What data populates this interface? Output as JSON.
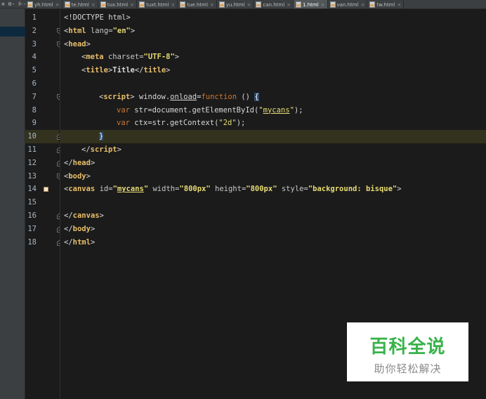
{
  "tabs": [
    {
      "label": "yh.html",
      "active": false
    },
    {
      "label": "te.html",
      "active": false
    },
    {
      "label": "tux.html",
      "active": false
    },
    {
      "label": "tuxt.html",
      "active": false
    },
    {
      "label": "tue.html",
      "active": false
    },
    {
      "label": "yu.html",
      "active": false
    },
    {
      "label": "can.html",
      "active": false
    },
    {
      "label": "1.html",
      "active": true
    },
    {
      "label": "van.html",
      "active": false
    },
    {
      "label": "tw.html",
      "active": false
    }
  ],
  "side_toolbar": "✲ ⚙- ⊩-",
  "editor": {
    "current_line": 10,
    "lines": [
      {
        "n": "1",
        "tokens": [
          [
            "br",
            "<"
          ],
          [
            "plain",
            "!DOCTYPE html"
          ],
          [
            "br",
            ">"
          ]
        ],
        "indent": 0
      },
      {
        "n": "2",
        "tokens": [
          [
            "br",
            "<"
          ],
          [
            "tag",
            "html"
          ],
          [
            "attr",
            " lang="
          ],
          [
            "val",
            "\"en\""
          ],
          [
            "br",
            ">"
          ]
        ],
        "indent": 0
      },
      {
        "n": "3",
        "tokens": [
          [
            "br",
            "<"
          ],
          [
            "tag",
            "head"
          ],
          [
            "br",
            ">"
          ]
        ],
        "indent": 0
      },
      {
        "n": "4",
        "tokens": [
          [
            "br",
            "<"
          ],
          [
            "tag",
            "meta"
          ],
          [
            "attr",
            " charset="
          ],
          [
            "val",
            "\"UTF-8\""
          ],
          [
            "br",
            ">"
          ]
        ],
        "indent": 1
      },
      {
        "n": "5",
        "tokens": [
          [
            "br",
            "<"
          ],
          [
            "tag",
            "title"
          ],
          [
            "br",
            ">"
          ],
          [
            "plainb",
            "Title"
          ],
          [
            "br",
            "</"
          ],
          [
            "tag",
            "title"
          ],
          [
            "br",
            ">"
          ]
        ],
        "indent": 1
      },
      {
        "n": "6",
        "tokens": [],
        "indent": 0
      },
      {
        "n": "7",
        "tokens": [
          [
            "br",
            "<"
          ],
          [
            "tag",
            "script"
          ],
          [
            "br",
            ">"
          ],
          [
            "plain",
            " window."
          ],
          [
            "under",
            "onload"
          ],
          [
            "plain",
            "="
          ],
          [
            "kw",
            "function"
          ],
          [
            "plain",
            " () "
          ],
          [
            "hl",
            "{"
          ]
        ],
        "indent": 2
      },
      {
        "n": "8",
        "tokens": [
          [
            "kw",
            "var"
          ],
          [
            "plain",
            " str=document.getElementById("
          ],
          [
            "strq",
            "\""
          ],
          [
            "struw",
            "mycans"
          ],
          [
            "strq",
            "\""
          ],
          [
            "plain",
            ");"
          ]
        ],
        "indent": 3
      },
      {
        "n": "9",
        "tokens": [
          [
            "kw",
            "var"
          ],
          [
            "plain",
            " ctx=str.getContext("
          ],
          [
            "str",
            "\"2d\""
          ],
          [
            "plain",
            ");"
          ]
        ],
        "indent": 3
      },
      {
        "n": "10",
        "tokens": [
          [
            "hl",
            "}"
          ]
        ],
        "indent": 2
      },
      {
        "n": "11",
        "tokens": [
          [
            "br",
            "</"
          ],
          [
            "tag",
            "script"
          ],
          [
            "br",
            ">"
          ]
        ],
        "indent": 1
      },
      {
        "n": "12",
        "tokens": [
          [
            "br",
            "</"
          ],
          [
            "tag",
            "head"
          ],
          [
            "br",
            ">"
          ]
        ],
        "indent": 0
      },
      {
        "n": "13",
        "tokens": [
          [
            "br",
            "<"
          ],
          [
            "tag",
            "body"
          ],
          [
            "br",
            ">"
          ]
        ],
        "indent": 0
      },
      {
        "n": "14",
        "tokens": [
          [
            "br",
            "<"
          ],
          [
            "tag",
            "canvas"
          ],
          [
            "attr",
            " id="
          ],
          [
            "valq",
            "\""
          ],
          [
            "valu",
            "mycans"
          ],
          [
            "valq",
            "\""
          ],
          [
            "attr",
            " width="
          ],
          [
            "val",
            "\"800px\""
          ],
          [
            "attr",
            " height="
          ],
          [
            "val",
            "\"800px\""
          ],
          [
            "attr",
            " style="
          ],
          [
            "val",
            "\"background: bisque\""
          ],
          [
            "br",
            ">"
          ]
        ],
        "indent": 0
      },
      {
        "n": "15",
        "tokens": [],
        "indent": 0
      },
      {
        "n": "16",
        "tokens": [
          [
            "br",
            "</"
          ],
          [
            "tag",
            "canvas"
          ],
          [
            "br",
            ">"
          ]
        ],
        "indent": 0
      },
      {
        "n": "17",
        "tokens": [
          [
            "br",
            "</"
          ],
          [
            "tag",
            "body"
          ],
          [
            "br",
            ">"
          ]
        ],
        "indent": 0
      },
      {
        "n": "18",
        "tokens": [
          [
            "br",
            "</"
          ],
          [
            "tag",
            "html"
          ],
          [
            "br",
            ">"
          ]
        ],
        "indent": 0
      }
    ]
  },
  "watermark": {
    "title": "百科全说",
    "subtitle": "助你轻松解决"
  },
  "colors": {
    "background": "#1b1b1b",
    "current_line": "#32321e",
    "tag": "#e8bf6a",
    "string": "#e6db74",
    "keyword": "#cc7832",
    "watermark_green": "#38b34a"
  }
}
